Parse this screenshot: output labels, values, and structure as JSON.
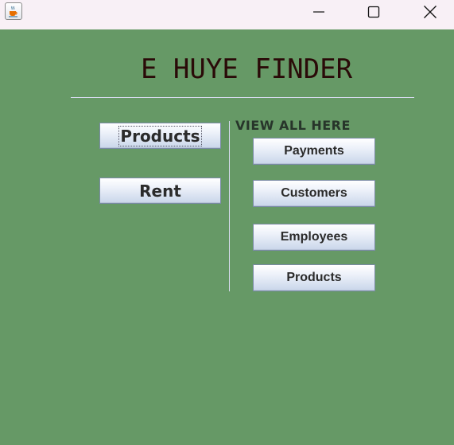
{
  "titlebar": {
    "app_icon": "java-coffee-cup-icon",
    "minimize_icon": "minimize-icon",
    "maximize_icon": "maximize-icon",
    "close_icon": "close-icon"
  },
  "colors": {
    "background": "#669966",
    "titlebar": "#f8f0f6",
    "title_text": "#2a0a08",
    "separator": "#d8dcf0",
    "button_text": "#2b2b2b"
  },
  "main": {
    "title": "E HUYE FINDER",
    "left_buttons": [
      {
        "label": "Products",
        "focused": true
      },
      {
        "label": "Rent",
        "focused": false
      }
    ],
    "view_all_label": "VIEW ALL HERE",
    "view_buttons": [
      {
        "label": "Payments"
      },
      {
        "label": "Customers"
      },
      {
        "label": "Employees"
      },
      {
        "label": "Products"
      }
    ]
  }
}
